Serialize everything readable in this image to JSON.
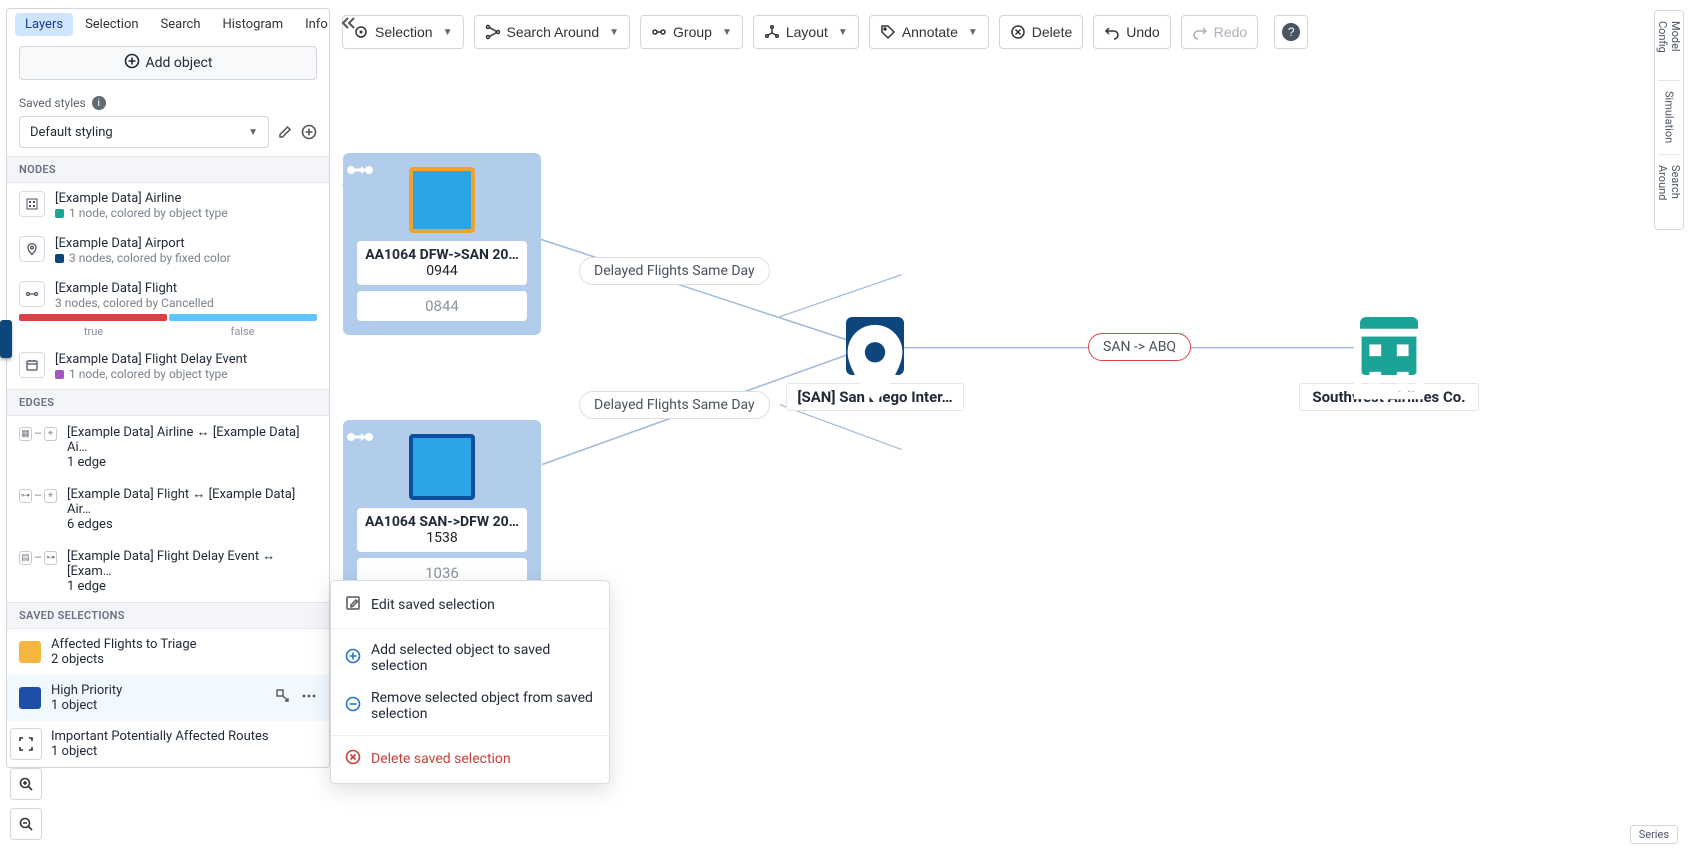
{
  "toolbar": {
    "selection": "Selection",
    "search_around": "Search Around",
    "group": "Group",
    "layout": "Layout",
    "annotate": "Annotate",
    "delete": "Delete",
    "undo": "Undo",
    "redo": "Redo"
  },
  "right_rail": {
    "model_config": "Model Config",
    "simulation": "Simulation",
    "search_around": "Search Around"
  },
  "series_status": "Series",
  "panel": {
    "tabs": [
      "Layers",
      "Selection",
      "Search",
      "Histogram",
      "Info"
    ],
    "add_object": "Add object",
    "saved_styles_label": "Saved styles",
    "default_styling": "Default styling",
    "sections": {
      "nodes": "NODES",
      "edges": "EDGES",
      "saved_selections": "SAVED SELECTIONS"
    },
    "nodes": [
      {
        "title": "[Example Data] Airline",
        "sub": "1 node, colored by object type",
        "swatch": "#1aa396"
      },
      {
        "title": "[Example Data] Airport",
        "sub": "3 nodes, colored by fixed color",
        "swatch": "#0d467c"
      },
      {
        "title": "[Example Data] Flight",
        "sub": "3 nodes, colored by Cancelled",
        "swatch": null
      },
      {
        "title": "[Example Data] Flight Delay Event",
        "sub": "1 node, colored by object type",
        "swatch": "#a257c0"
      }
    ],
    "flight_bar": {
      "true_label": "true",
      "false_label": "false"
    },
    "edges": [
      {
        "title": "[Example Data] Airline ↔ [Example Data] Ai…",
        "sub": "1 edge"
      },
      {
        "title": "[Example Data] Flight ↔ [Example Data] Air…",
        "sub": "6 edges"
      },
      {
        "title": "[Example Data] Flight Delay Event ↔ [Exam…",
        "sub": "1 edge"
      }
    ],
    "saved_selections": [
      {
        "title": "Affected Flights to Triage",
        "sub": "2 objects",
        "color": "#f4b63f"
      },
      {
        "title": "High Priority",
        "sub": "1 object",
        "color": "#1e4fa7"
      },
      {
        "title": "Important Potentially Affected Routes",
        "sub": "1 object",
        "color": "#d0393f"
      }
    ]
  },
  "context_menu": {
    "edit": "Edit saved selection",
    "add": "Add selected object to saved selection",
    "remove": "Remove selected object from saved selection",
    "delete": "Delete saved selection"
  },
  "graph": {
    "cluster1": {
      "title": "AA1064 DFW->SAN 20…",
      "metric1": "0944",
      "metric2": "0844"
    },
    "cluster2": {
      "title": "AA1064 SAN->DFW 20…",
      "metric1": "1538",
      "metric2": "1036"
    },
    "airport": "[SAN] San Diego Inter…",
    "airline": "Southwest Airlines Co.",
    "edge_delayed": "Delayed Flights Same Day",
    "edge_route": "SAN -> ABQ"
  }
}
